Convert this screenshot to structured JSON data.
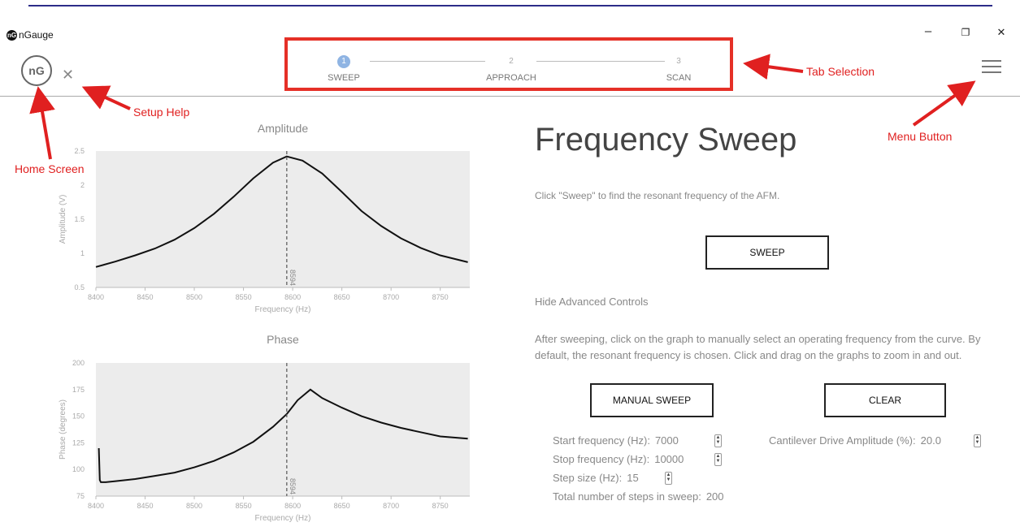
{
  "app": {
    "title": "nGauge",
    "logo_glyph": "nG",
    "home_glyph": "nG"
  },
  "window_controls": {
    "minimize": "–",
    "maximize": "❐",
    "close": "✕"
  },
  "tabs": [
    {
      "num": "1",
      "label": "SWEEP",
      "active": true
    },
    {
      "num": "2",
      "label": "APPROACH",
      "active": false
    },
    {
      "num": "3",
      "label": "SCAN",
      "active": false
    }
  ],
  "annotations": {
    "tab_selection": "Tab Selection",
    "setup_help": "Setup Help",
    "home_screen": "Home Screen",
    "menu_button": "Menu Button"
  },
  "page": {
    "title": "Frequency Sweep",
    "intro": "Click \"Sweep\" to find the resonant frequency of the AFM.",
    "sweep_button": "SWEEP",
    "advanced_toggle": "Hide Advanced Controls",
    "advanced_desc_1": "After sweeping, click on the graph to manually select an operating frequency from the curve. By",
    "advanced_desc_2": "default, the resonant frequency is chosen. Click and drag on the graphs to zoom in and out.",
    "manual_sweep_button": "MANUAL SWEEP",
    "clear_button": "CLEAR"
  },
  "fields": {
    "start_label": "Start frequency (Hz):",
    "start_value": "7000",
    "stop_label": "Stop frequency (Hz):",
    "stop_value": "10000",
    "step_label": "Step size (Hz):",
    "step_value": "15",
    "total_label": "Total number of steps in sweep:",
    "total_value": "200",
    "drive_label": "Cantilever Drive Amplitude (%):",
    "drive_value": "20.0"
  },
  "colors": {
    "annotation": "#e02020",
    "accent": "#8fb4e3",
    "plot_bg": "#ececec"
  },
  "chart_data": [
    {
      "type": "line",
      "title": "Amplitude",
      "xlabel": "Frequency (Hz)",
      "ylabel": "Amplitude (V)",
      "xlim": [
        8400,
        8780
      ],
      "ylim": [
        0.5,
        2.5
      ],
      "xticks": [
        "8400",
        "8450",
        "8500",
        "8550",
        "8600",
        "8650",
        "8700",
        "8750"
      ],
      "yticks": [
        "0.5",
        "1",
        "1.5",
        "2",
        "2.5"
      ],
      "marker": {
        "x": 8594,
        "label": "8594"
      },
      "x": [
        8400,
        8420,
        8440,
        8460,
        8480,
        8500,
        8520,
        8540,
        8560,
        8580,
        8594,
        8610,
        8630,
        8650,
        8670,
        8690,
        8710,
        8730,
        8750,
        8778
      ],
      "y": [
        0.8,
        0.88,
        0.97,
        1.07,
        1.2,
        1.37,
        1.58,
        1.83,
        2.1,
        2.33,
        2.42,
        2.36,
        2.17,
        1.9,
        1.62,
        1.4,
        1.22,
        1.08,
        0.97,
        0.87
      ]
    },
    {
      "type": "line",
      "title": "Phase",
      "xlabel": "Frequency (Hz)",
      "ylabel": "Phase (degrees)",
      "xlim": [
        8400,
        8780
      ],
      "ylim": [
        75,
        200
      ],
      "xticks": [
        "8400",
        "8450",
        "8500",
        "8550",
        "8600",
        "8650",
        "8700",
        "8750"
      ],
      "yticks": [
        "75",
        "100",
        "125",
        "150",
        "175",
        "200"
      ],
      "marker": {
        "x": 8594,
        "label": "8594"
      },
      "x": [
        8403,
        8404,
        8405,
        8410,
        8420,
        8440,
        8460,
        8480,
        8500,
        8520,
        8540,
        8560,
        8580,
        8594,
        8605,
        8618,
        8630,
        8650,
        8670,
        8690,
        8710,
        8730,
        8750,
        8778
      ],
      "y": [
        120,
        90,
        88,
        88,
        89,
        91,
        94,
        97,
        102,
        108,
        116,
        126,
        140,
        152,
        165,
        175,
        167,
        158,
        150,
        144,
        139,
        135,
        131,
        129
      ]
    }
  ]
}
